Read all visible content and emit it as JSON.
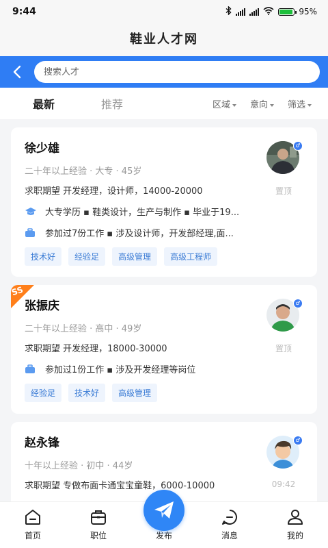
{
  "status": {
    "time": "9:44",
    "battery": "95%",
    "battery_level": 0.95
  },
  "app": {
    "title": "鞋业人才网"
  },
  "search": {
    "placeholder": "搜索人才"
  },
  "tabs": [
    {
      "label": "最新"
    },
    {
      "label": "推荐"
    }
  ],
  "filters": [
    {
      "label": "区域"
    },
    {
      "label": "意向"
    },
    {
      "label": "筛选"
    }
  ],
  "cards": [
    {
      "name": "徐少雄",
      "meta": "二十年以上经验 · 大专 · 45岁",
      "want": "求职期望  开发经理，设计师，14000-20000",
      "education": "大专学历  ▪  鞋类设计，生产与制作  ▪  毕业于19...",
      "work": "参加过7份工作  ▪  涉及设计师，开发部经理,面...",
      "tags": [
        "技术好",
        "经验足",
        "高级管理",
        "高级工程师"
      ],
      "sub": "置顶"
    },
    {
      "badge": "SS",
      "name": "张振庆",
      "meta": "二十年以上经验 · 高中 · 49岁",
      "want": "求职期望  开发经理，18000-30000",
      "work": "参加过1份工作  ▪  涉及开发经理等岗位",
      "tags": [
        "经验足",
        "技术好",
        "高级管理"
      ],
      "sub": "置顶"
    },
    {
      "name": "赵永锋",
      "meta": "十年以上经验 · 初中 · 44岁",
      "want": "求职期望  专做布面卡通宝宝童鞋，6000-10000",
      "sub": "09:42"
    }
  ],
  "nav": [
    {
      "label": "首页",
      "icon": "home-icon"
    },
    {
      "label": "职位",
      "icon": "briefcase-icon"
    },
    {
      "label": "发布",
      "icon": "paper-plane-icon"
    },
    {
      "label": "消息",
      "icon": "message-icon"
    },
    {
      "label": "我的",
      "icon": "user-icon"
    }
  ],
  "colors": {
    "accent": "#2f7df4",
    "tag_bg": "#eef4fd",
    "tag_text": "#3a7bd5",
    "badge": "#ff7f1a"
  }
}
